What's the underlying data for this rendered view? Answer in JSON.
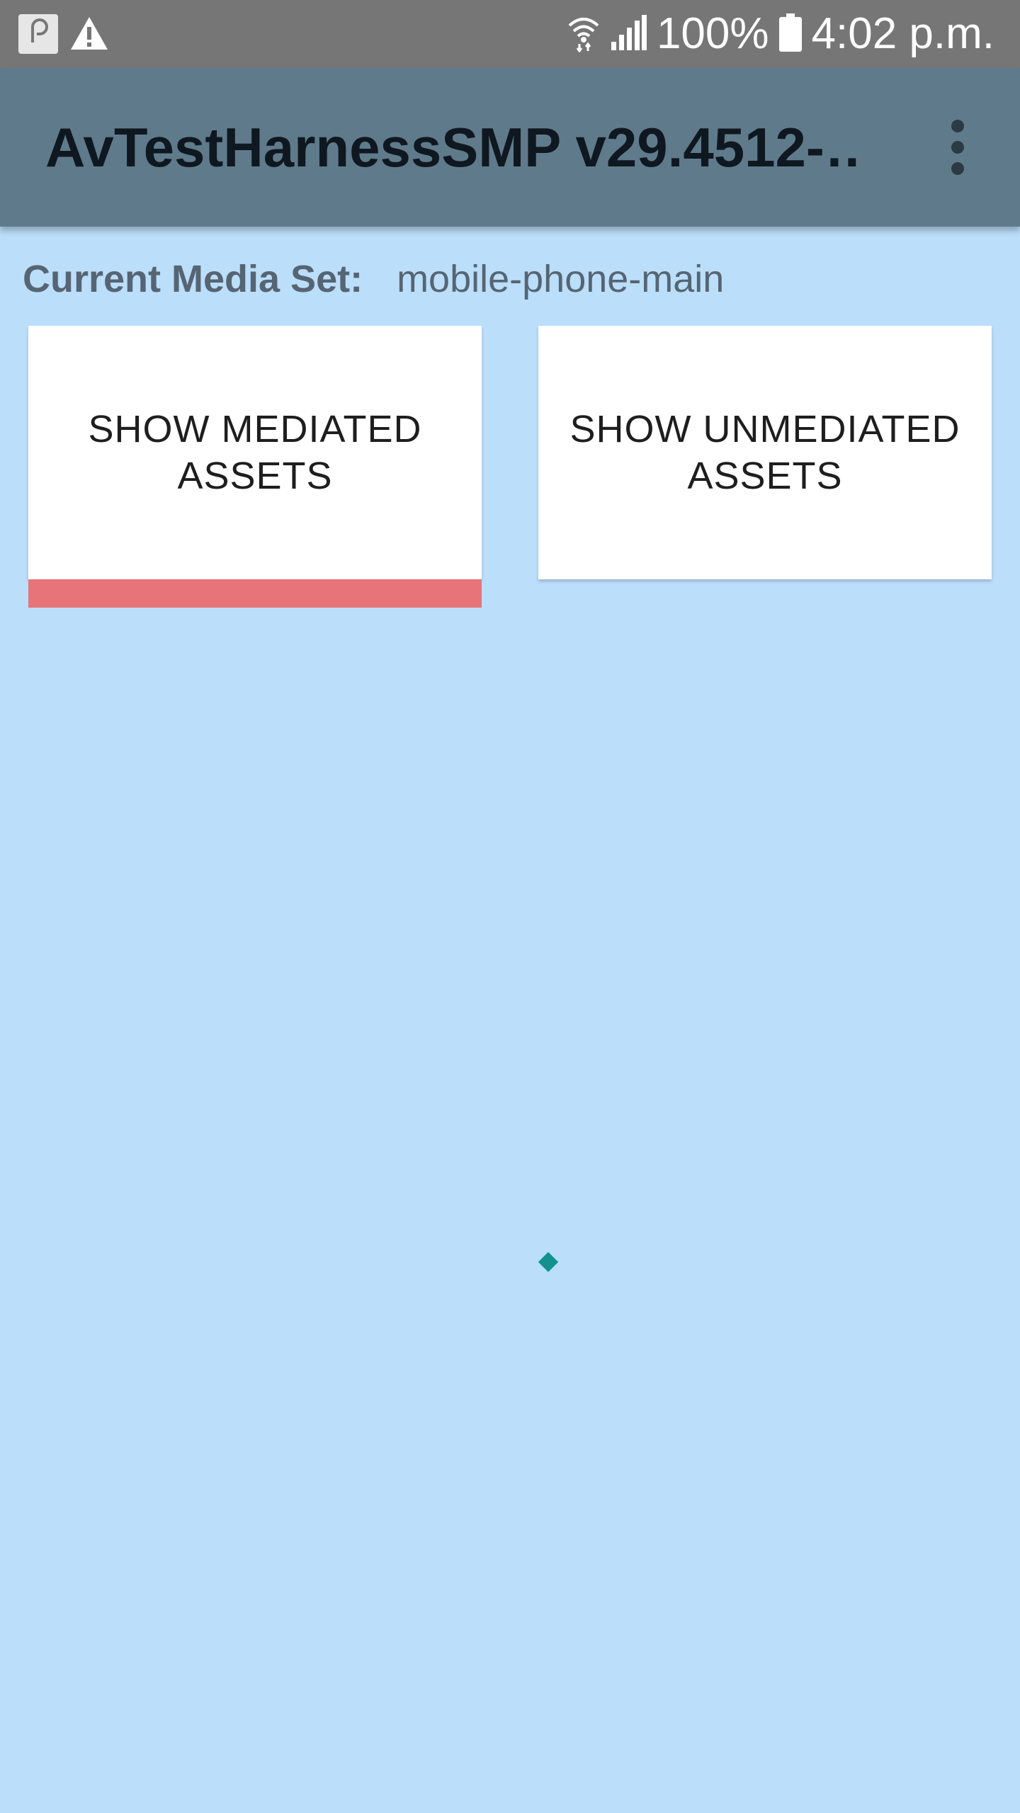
{
  "status_bar": {
    "battery": "100%",
    "time": "4:02 p.m.",
    "notification_icons": [
      "p-notification-icon",
      "warning-icon"
    ],
    "system_icons": [
      "wifi-icon",
      "signal-icon",
      "battery-icon"
    ]
  },
  "app_bar": {
    "title": "AvTestHarnessSMP v29.4512-…",
    "overflow_icon": "more-vert-icon"
  },
  "media_set": {
    "label": "Current Media Set:",
    "value": "mobile-phone-main"
  },
  "tabs": [
    {
      "label": "SHOW MEDIATED ASSETS",
      "selected": true
    },
    {
      "label": "SHOW UNMEDIATED ASSETS",
      "selected": false
    }
  ],
  "colors": {
    "background": "#bbdefa",
    "status_bar": "#767676",
    "app_bar": "#5f7b8b",
    "tab_indicator": "#e67479",
    "spinner": "#12918e"
  }
}
